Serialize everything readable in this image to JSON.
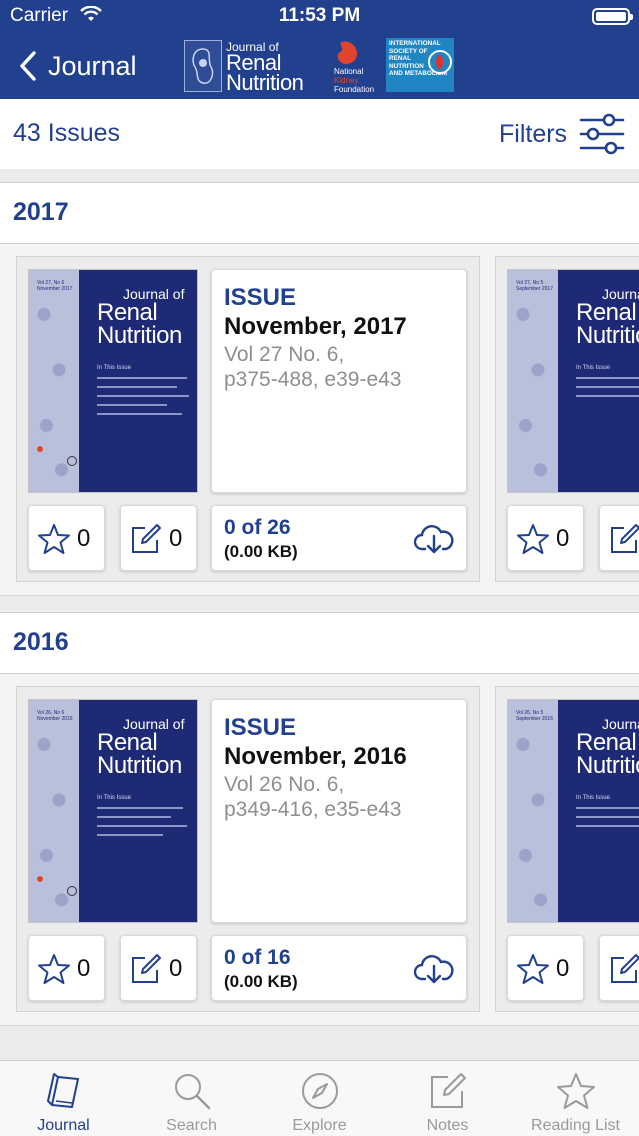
{
  "status_bar": {
    "carrier": "Carrier",
    "time": "11:53 PM"
  },
  "nav": {
    "back_label": "Journal",
    "logos": {
      "jrn": {
        "line1": "Journal of",
        "line2": "Renal",
        "line3": "Nutrition"
      },
      "nkf": {
        "line1": "National",
        "line2": "Kidney",
        "line3": "Foundation"
      },
      "isrnm": {
        "lines": [
          "INTERNATIONAL",
          "SOCIETY OF",
          "RENAL",
          "NUTRITION",
          "AND METABOLISM"
        ]
      }
    }
  },
  "toolbar": {
    "issue_count": "43 Issues",
    "filters_label": "Filters"
  },
  "years": [
    {
      "year": "2017",
      "issues": [
        {
          "label": "ISSUE",
          "date": "November, 2017",
          "volume": "Vol 27 No. 6,",
          "pages": "p375-488, e39-e43",
          "download_progress": "0 of 26",
          "download_size": "(0.00 KB)",
          "favorites": "0",
          "notes": "0",
          "cover": {
            "vol_line1": "Vol 27, No 6",
            "vol_line2": "November 2017",
            "title1": "Journal of",
            "title2": "Renal",
            "title3": "Nutrition",
            "intro": "In This Issue"
          }
        },
        {
          "favorites": "0",
          "cover": {
            "vol_line1": "Vol 27, No 5",
            "vol_line2": "September 2017",
            "title1": "Journal of",
            "title2": "Renal",
            "title3": "Nutrition",
            "intro": "In This Issue"
          }
        }
      ]
    },
    {
      "year": "2016",
      "issues": [
        {
          "label": "ISSUE",
          "date": "November, 2016",
          "volume": "Vol 26 No. 6,",
          "pages": "p349-416, e35-e43",
          "download_progress": "0 of 16",
          "download_size": "(0.00 KB)",
          "favorites": "0",
          "notes": "0",
          "cover": {
            "vol_line1": "Vol 26, No 6",
            "vol_line2": "November 2016",
            "title1": "Journal of",
            "title2": "Renal",
            "title3": "Nutrition",
            "intro": "In This Issue"
          }
        },
        {
          "favorites": "0",
          "cover": {
            "vol_line1": "Vol 26, No 5",
            "vol_line2": "September 2016",
            "title1": "Journal of",
            "title2": "Renal",
            "title3": "Nutrition",
            "intro": "In This Issue"
          }
        }
      ]
    }
  ],
  "tabs": [
    {
      "label": "Journal",
      "icon": "book-icon",
      "active": true
    },
    {
      "label": "Search",
      "icon": "magnifier-icon"
    },
    {
      "label": "Explore",
      "icon": "compass-icon"
    },
    {
      "label": "Notes",
      "icon": "note-icon"
    },
    {
      "label": "Reading List",
      "icon": "star-icon"
    }
  ],
  "colors": {
    "brand": "#21408e",
    "cover_blue": "#1e2a76",
    "isrnm_blue": "#1f86c3",
    "nkf_orange": "#e2452f"
  }
}
